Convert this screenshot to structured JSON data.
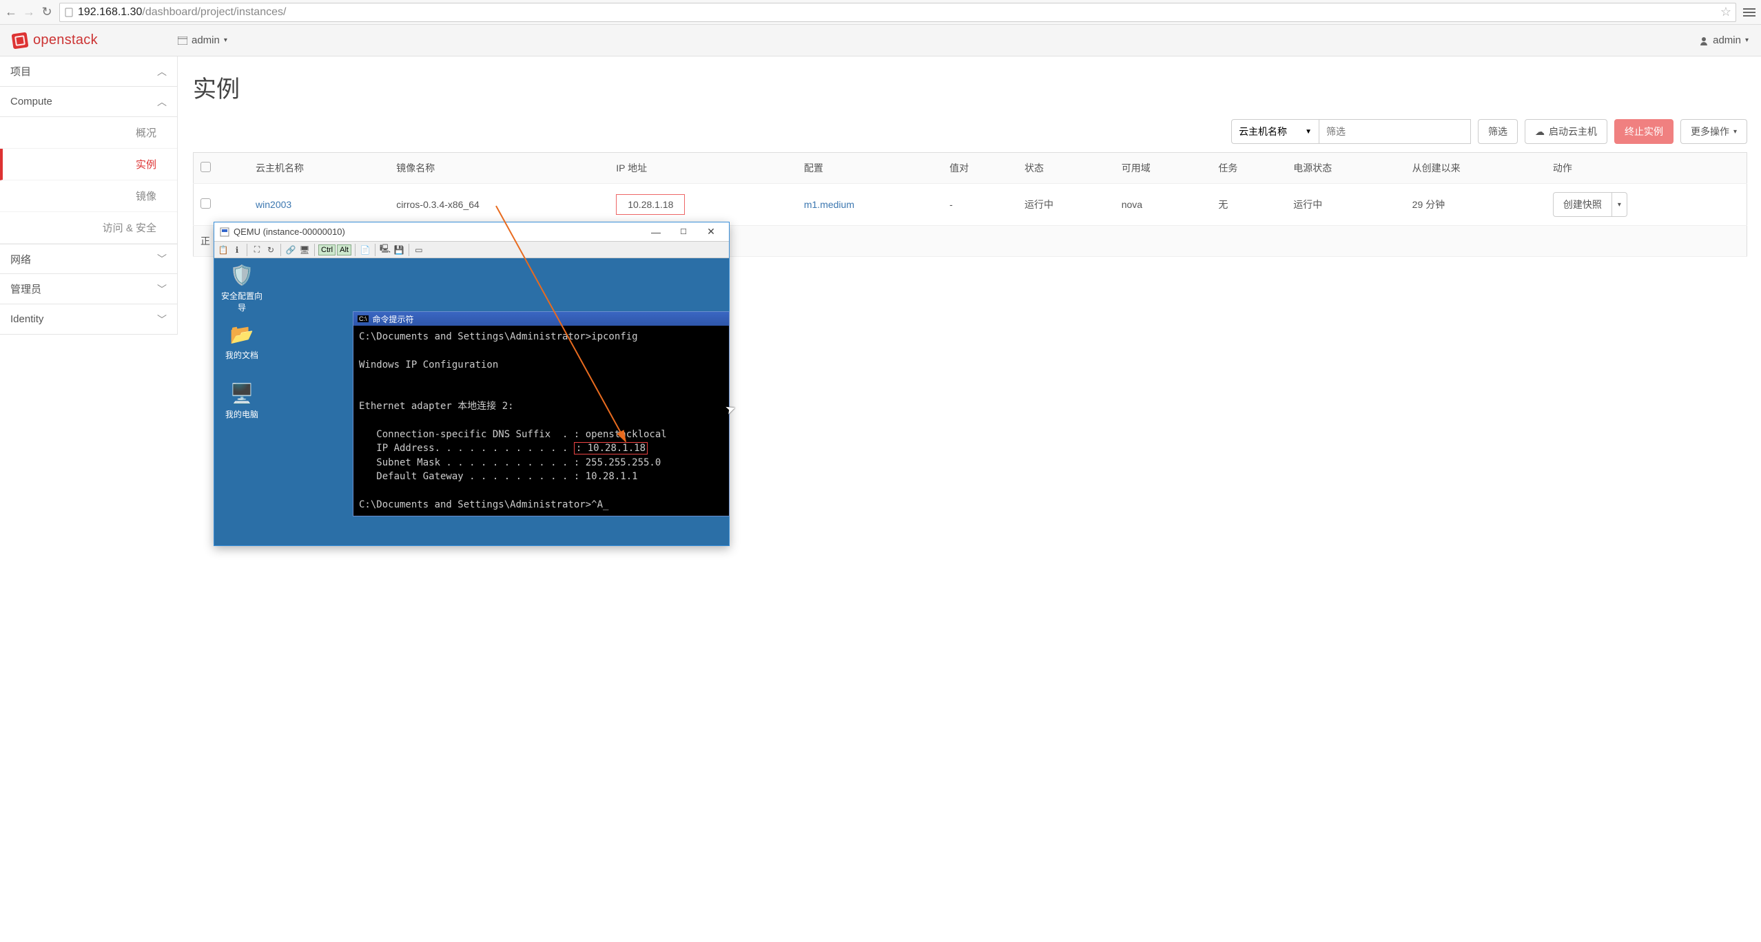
{
  "browser": {
    "host": "192.168.1.30",
    "path": "/dashboard/project/instances/"
  },
  "brand": "openstack",
  "project_selector": "admin",
  "user_selector": "admin",
  "sidebar": {
    "project": "项目",
    "compute": "Compute",
    "items": {
      "overview": "概况",
      "instances": "实例",
      "images": "镜像",
      "access": "访问 & 安全"
    },
    "network": "网络",
    "admin": "管理员",
    "identity": "Identity"
  },
  "page": {
    "title": "实例",
    "filter_by": "云主机名称",
    "filter_placeholder": "筛选",
    "filter_btn": "筛选",
    "launch_btn": "启动云主机",
    "terminate_btn": "终止实例",
    "more_btn": "更多操作",
    "displaying": "正"
  },
  "table": {
    "headers": {
      "name": "云主机名称",
      "image": "镜像名称",
      "ip": "IP 地址",
      "flavor": "配置",
      "keypair": "值对",
      "status": "状态",
      "az": "可用域",
      "task": "任务",
      "power": "电源状态",
      "uptime": "从创建以来",
      "actions": "动作"
    },
    "rows": [
      {
        "name": "win2003",
        "image": "cirros-0.3.4-x86_64",
        "ip": "10.28.1.18",
        "flavor": "m1.medium",
        "keypair": "-",
        "status": "运行中",
        "az": "nova",
        "task": "无",
        "power": "运行中",
        "uptime": "29 分钟",
        "action": "创建快照"
      }
    ]
  },
  "qemu": {
    "title": "QEMU (instance-00000010)",
    "tb": {
      "ctrl": "Ctrl",
      "alt": "Alt"
    },
    "desktop": {
      "wizard": "安全配置向导",
      "docs": "我的文档",
      "computer": "我的电脑"
    },
    "cmd": {
      "title": "命令提示符",
      "line1": "C:\\Documents and Settings\\Administrator>ipconfig",
      "line2": "Windows IP Configuration",
      "line3": "Ethernet adapter 本地连接 2:",
      "dns": "   Connection-specific DNS Suffix  . : openstacklocal",
      "ip_label": "   IP Address. . . . . . . . . . . . ",
      "ip_value": ": 10.28.1.18",
      "mask": "   Subnet Mask . . . . . . . . . . . : 255.255.255.0",
      "gw": "   Default Gateway . . . . . . . . . : 10.28.1.1",
      "prompt2": "C:\\Documents and Settings\\Administrator>^A_"
    }
  }
}
